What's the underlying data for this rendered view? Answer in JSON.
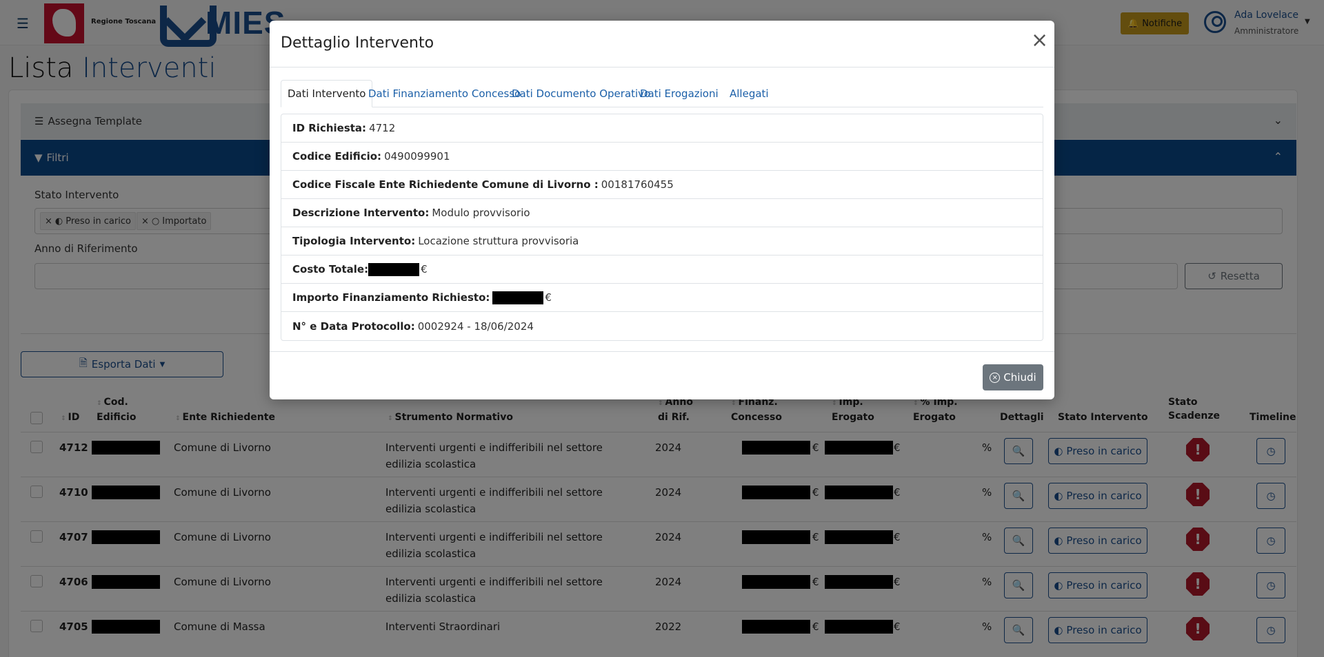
{
  "header": {
    "brand_text": "Regione Toscana",
    "app_name": "MIES",
    "notifications_label": "Notifiche",
    "user_name": "Ada Lovelace",
    "user_role": "Amministratore"
  },
  "page": {
    "title_plain": "Lista",
    "title_accent": "Interventi"
  },
  "accordions": {
    "template_label": "Assegna Template",
    "filters_label": "Filtri"
  },
  "filters": {
    "stato_label": "Stato Intervento",
    "stato_chips": [
      "Preso in carico",
      "Importato"
    ],
    "anno_label": "Anno di Riferimento",
    "reset_label": "Resetta"
  },
  "export_label": "Esporta Dati",
  "table": {
    "headers": {
      "id": "ID",
      "cod_edificio": "Cod. Edificio",
      "ente": "Ente Richiedente",
      "strumento": "Strumento Normativo",
      "anno": "Anno di Rif.",
      "finanz": "Finanz. Concesso",
      "imp": "Imp. Erogato",
      "perc": "% Imp. Erogato",
      "dettagli": "Dettagli",
      "stato": "Stato Intervento",
      "scadenze": "Stato Scadenze",
      "timeline": "Timeline"
    },
    "currency": "€",
    "percent": "%",
    "state_label": "Preso in carico",
    "rows": [
      {
        "id": "4712",
        "ente": "Comune di Livorno",
        "strumento": "Interventi urgenti e indifferibili nel settore edilizia scolastica",
        "anno": "2024"
      },
      {
        "id": "4710",
        "ente": "Comune di Livorno",
        "strumento": "Interventi urgenti e indifferibili nel settore edilizia scolastica",
        "anno": "2024"
      },
      {
        "id": "4707",
        "ente": "Comune di Livorno",
        "strumento": "Interventi urgenti e indifferibili nel settore edilizia scolastica",
        "anno": "2024"
      },
      {
        "id": "4706",
        "ente": "Comune di Livorno",
        "strumento": "Interventi urgenti e indifferibili nel settore edilizia scolastica",
        "anno": "2024"
      },
      {
        "id": "4705",
        "ente": "Comune di Massa",
        "strumento": "Interventi Straordinari",
        "anno": "2022"
      }
    ]
  },
  "modal": {
    "title": "Dettaglio Intervento",
    "tabs": [
      "Dati Intervento",
      "Dati Finanziamento Concesso",
      "Dati Documento Operativo",
      "Dati Erogazioni",
      "Allegati"
    ],
    "active_tab": "Dati Intervento",
    "details": [
      {
        "key": "ID Richiesta:",
        "value": "4712"
      },
      {
        "key": "Codice Edificio:",
        "value": "0490099901"
      },
      {
        "key": "Codice Fiscale Ente Richiedente Comune di Livorno :",
        "value": "00181760455"
      },
      {
        "key": "Descrizione Intervento:",
        "value": "Modulo provvisorio"
      },
      {
        "key": "Tipologia Intervento:",
        "value": "Locazione struttura provvisoria"
      },
      {
        "key": "Costo Totale:",
        "value": "€",
        "redacted": true
      },
      {
        "key": "Importo Finanziamento Richiesto:",
        "value": "€",
        "redacted": true
      },
      {
        "key": "N° e Data Protocollo:",
        "value": "0002924 - 18/06/2024"
      }
    ],
    "close_label": "Chiudi"
  },
  "colors": {
    "primary": "#1b4f8f",
    "filter_bar": "#0a4a8c",
    "notif": "#c79a1c",
    "alert": "#b3192b",
    "close_btn": "#6c757d"
  }
}
